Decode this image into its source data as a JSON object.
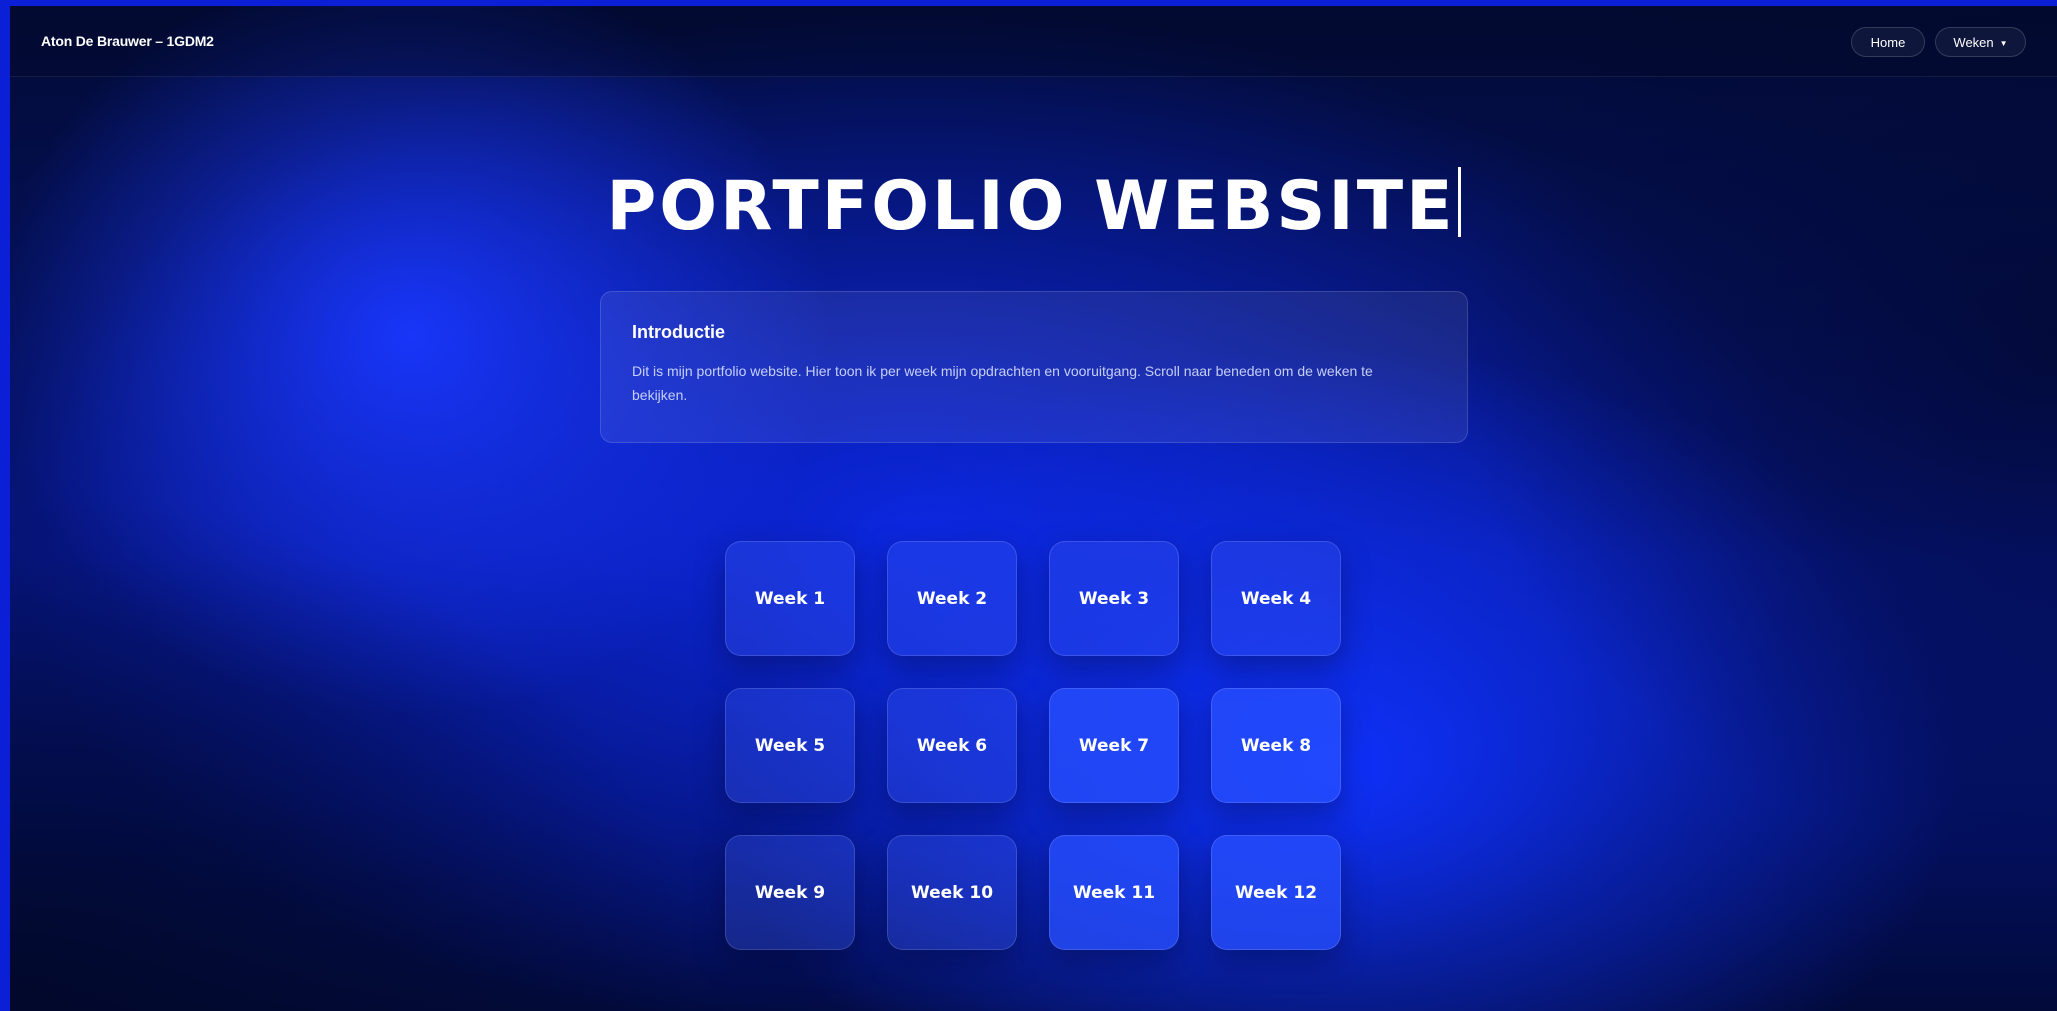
{
  "navbar": {
    "brand": "Aton De Brauwer – 1GDM2",
    "home_label": "Home",
    "weeks_label": "Weken",
    "weeks_caret_icon": "caret-down-icon"
  },
  "hero": {
    "title": "PORTFOLIO WEBSITE"
  },
  "intro": {
    "heading": "Introductie",
    "text": "Dit is mijn portfolio website. Hier toon ik per week mijn opdrachten en vooruitgang. Scroll naar beneden om de weken te bekijken."
  },
  "weeks": [
    {
      "label": "Week 1"
    },
    {
      "label": "Week 2"
    },
    {
      "label": "Week 3"
    },
    {
      "label": "Week 4"
    },
    {
      "label": "Week 5"
    },
    {
      "label": "Week 6"
    },
    {
      "label": "Week 7"
    },
    {
      "label": "Week 8"
    },
    {
      "label": "Week 9"
    },
    {
      "label": "Week 10"
    },
    {
      "label": "Week 11"
    },
    {
      "label": "Week 12"
    }
  ],
  "colors": {
    "frame_border": "#0b1fd6",
    "background_dark": "#020b35",
    "accent_blue": "#1937ff"
  }
}
